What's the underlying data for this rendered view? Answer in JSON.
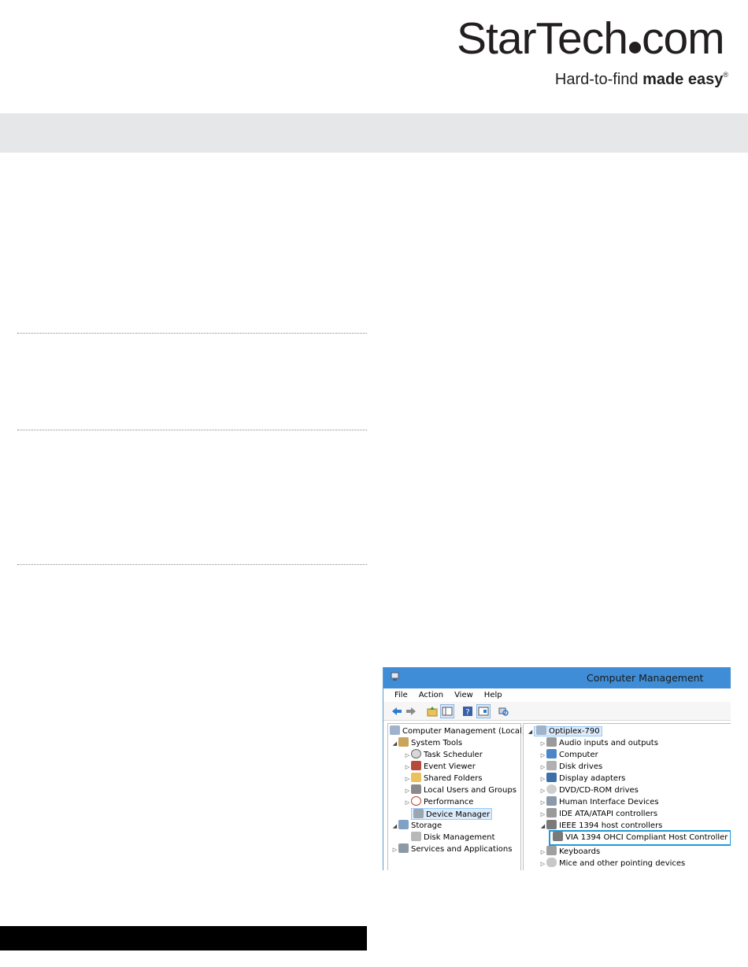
{
  "logo": {
    "main_left": "StarTech",
    "main_right": "com",
    "tagline_regular": "Hard-to-find ",
    "tagline_bold": "made easy",
    "registered": "®"
  },
  "colors": {
    "band": "#e6e7e8",
    "footer_bar": "#000000",
    "titlebar": "#3e8dd6",
    "highlight_border": "#1e9ad6"
  },
  "screenshot": {
    "window_title": "Computer Management",
    "menu": [
      "File",
      "Action",
      "View",
      "Help"
    ],
    "toolbar_icons": [
      "back-arrow-icon",
      "forward-arrow-icon",
      "up-folder-icon",
      "show-hide-tree-icon",
      "help-icon",
      "properties-icon",
      "scan-hardware-icon"
    ],
    "left_tree": [
      {
        "label": "Computer Management (Local)",
        "icon": "computer-management-icon",
        "arrow": ""
      },
      {
        "label": "System Tools",
        "icon": "tools-icon",
        "arrow": "◢"
      },
      {
        "label": "Task Scheduler",
        "icon": "clock-icon",
        "arrow": "▷"
      },
      {
        "label": "Event Viewer",
        "icon": "event-viewer-icon",
        "arrow": "▷"
      },
      {
        "label": "Shared Folders",
        "icon": "shared-folder-icon",
        "arrow": "▷"
      },
      {
        "label": "Local Users and Groups",
        "icon": "users-icon",
        "arrow": "▷"
      },
      {
        "label": "Performance",
        "icon": "performance-icon",
        "arrow": "▷"
      },
      {
        "label": "Device Manager",
        "icon": "device-manager-icon",
        "arrow": ""
      },
      {
        "label": "Storage",
        "icon": "storage-icon",
        "arrow": "◢"
      },
      {
        "label": "Disk Management",
        "icon": "disk-management-icon",
        "arrow": ""
      },
      {
        "label": "Services and Applications",
        "icon": "services-icon",
        "arrow": "▷"
      }
    ],
    "right_tree": [
      {
        "label": "Optiplex-790",
        "icon": "computer-icon",
        "arrow": "◢"
      },
      {
        "label": "Audio inputs and outputs",
        "icon": "speaker-icon",
        "arrow": "▷"
      },
      {
        "label": "Computer",
        "icon": "monitor-icon",
        "arrow": "▷"
      },
      {
        "label": "Disk drives",
        "icon": "disk-drive-icon",
        "arrow": "▷"
      },
      {
        "label": "Display adapters",
        "icon": "display-adapter-icon",
        "arrow": "▷"
      },
      {
        "label": "DVD/CD-ROM drives",
        "icon": "dvd-icon",
        "arrow": "▷"
      },
      {
        "label": "Human Interface Devices",
        "icon": "hid-icon",
        "arrow": "▷"
      },
      {
        "label": "IDE ATA/ATAPI controllers",
        "icon": "ide-icon",
        "arrow": "▷"
      },
      {
        "label": "IEEE 1394 host controllers",
        "icon": "firewire-icon",
        "arrow": "◢"
      },
      {
        "label": "VIA 1394 OHCI Compliant Host Controller",
        "icon": "firewire-device-icon",
        "arrow": ""
      },
      {
        "label": "Keyboards",
        "icon": "keyboard-icon",
        "arrow": "▷"
      },
      {
        "label": "Mice and other pointing devices",
        "icon": "mouse-icon",
        "arrow": "▷"
      }
    ]
  }
}
